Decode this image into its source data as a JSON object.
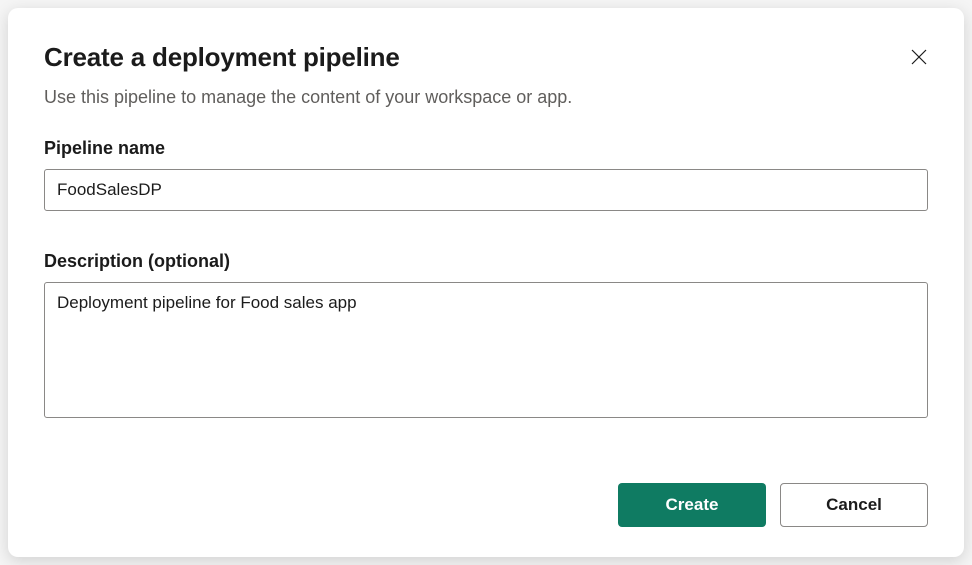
{
  "dialog": {
    "title": "Create a deployment pipeline",
    "subtitle": "Use this pipeline to manage the content of your workspace or app."
  },
  "fields": {
    "name": {
      "label": "Pipeline name",
      "value": "FoodSalesDP"
    },
    "description": {
      "label": "Description (optional)",
      "value": "Deployment pipeline for Food sales app"
    }
  },
  "buttons": {
    "primary": "Create",
    "secondary": "Cancel"
  },
  "colors": {
    "primary": "#0f7b62",
    "border": "#8a8886",
    "text": "#1b1b1b",
    "subtitle": "#605e5c"
  }
}
